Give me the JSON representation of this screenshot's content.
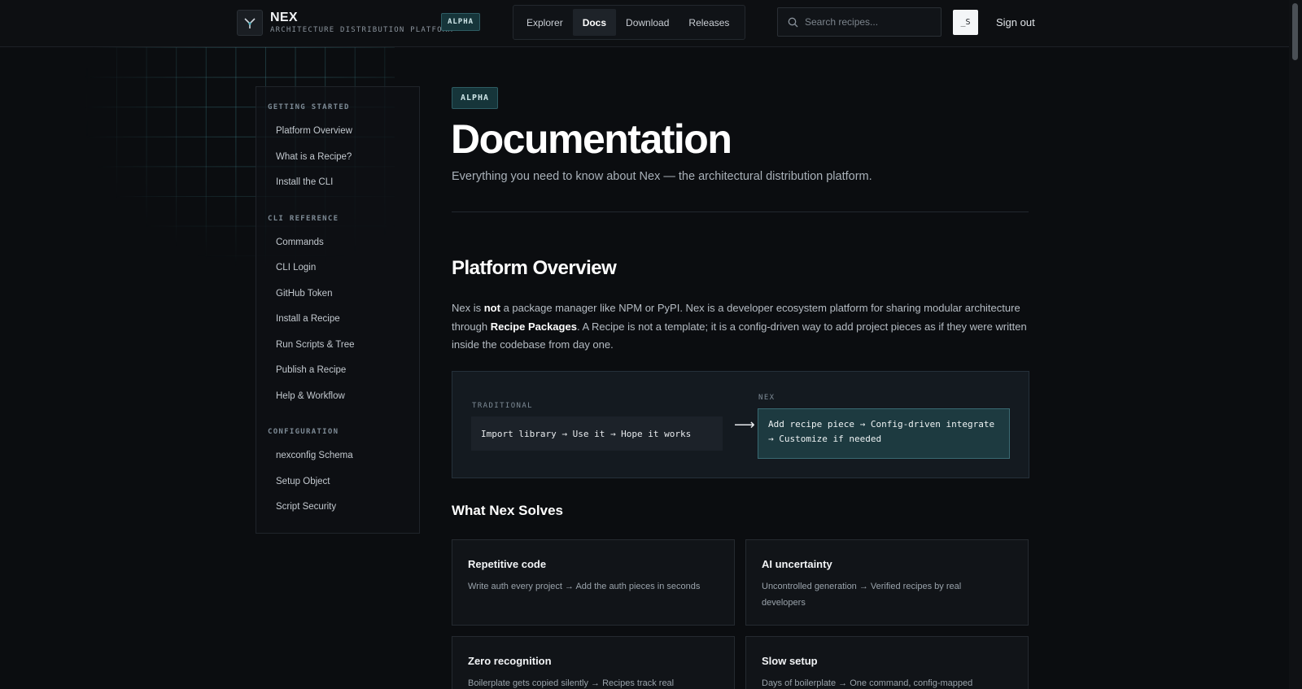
{
  "header": {
    "brand_name": "NEX",
    "brand_subtitle": "ARCHITECTURE DISTRIBUTION PLATFORM",
    "badge": "ALPHA",
    "nav": [
      {
        "label": "Explorer",
        "active": false
      },
      {
        "label": "Docs",
        "active": true
      },
      {
        "label": "Download",
        "active": false
      },
      {
        "label": "Releases",
        "active": false
      }
    ],
    "search_placeholder": "Search recipes...",
    "avatar_initials": "_S",
    "sign_out": "Sign out"
  },
  "sidebar": {
    "sections": [
      {
        "heading": "GETTING STARTED",
        "items": [
          "Platform Overview",
          "What is a Recipe?",
          "Install the CLI"
        ]
      },
      {
        "heading": "CLI REFERENCE",
        "items": [
          "Commands",
          "CLI Login",
          "GitHub Token",
          "Install a Recipe",
          "Run Scripts & Tree",
          "Publish a Recipe",
          "Help & Workflow"
        ]
      },
      {
        "heading": "CONFIGURATION",
        "items": [
          "nexconfig Schema",
          "Setup Object",
          "Script Security"
        ]
      }
    ]
  },
  "main": {
    "badge": "ALPHA",
    "title": "Documentation",
    "subtitle": "Everything you need to know about Nex — the architectural distribution platform.",
    "overview": {
      "heading": "Platform Overview",
      "p_1": "Nex is ",
      "p_2": "not",
      "p_3": " a package manager like NPM or PyPI. Nex is a developer ecosystem platform for sharing modular architecture through ",
      "p_4": "Recipe Packages",
      "p_5": ". A Recipe is not a template; it is a config-driven way to add project pieces as if they were written inside the codebase from day one."
    },
    "compare": {
      "traditional_label": "TRADITIONAL",
      "traditional_text": "Import library → Use it → Hope it works",
      "arrow": "⟶",
      "nex_label": "NEX",
      "nex_line1": "Add recipe piece → Config-driven integrate",
      "nex_line2": "→ Customize if needed"
    },
    "solves": {
      "heading": "What Nex Solves",
      "cards": [
        {
          "title": "Repetitive code",
          "text": "Write auth every project → Add the auth pieces in seconds"
        },
        {
          "title": "AI uncertainty",
          "text": "Uncontrolled generation → Verified recipes by real developers"
        },
        {
          "title": "Zero recognition",
          "text": "Boilerplate gets copied silently → Recipes track real"
        },
        {
          "title": "Slow setup",
          "text": "Days of boilerplate → One command, config-mapped"
        }
      ]
    }
  }
}
